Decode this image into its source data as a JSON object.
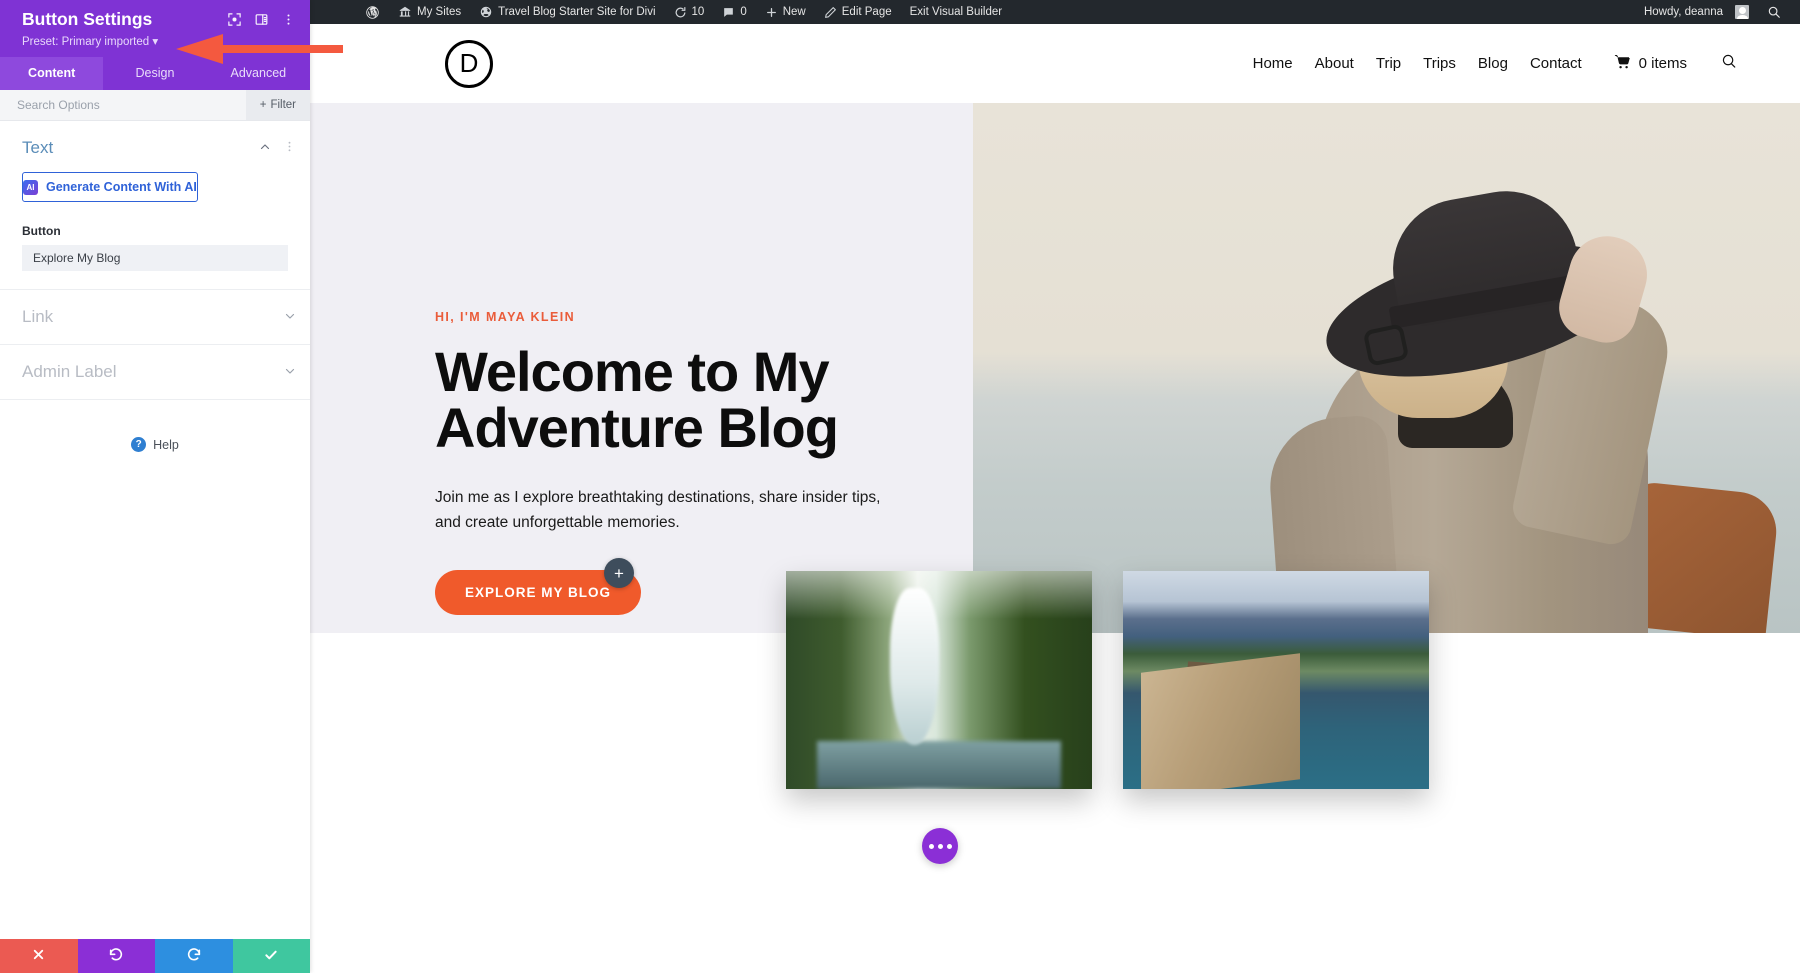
{
  "adminbar": {
    "items": [
      {
        "icon": "wordpress-icon",
        "label": ""
      },
      {
        "icon": "my-sites-icon",
        "label": "My Sites"
      },
      {
        "icon": "site-icon",
        "label": "Travel Blog Starter Site for Divi"
      },
      {
        "icon": "updates-icon",
        "label": "10"
      },
      {
        "icon": "comments-icon",
        "label": "0"
      },
      {
        "icon": "plus-icon",
        "label": "New"
      },
      {
        "icon": "pencil-icon",
        "label": "Edit Page"
      },
      {
        "icon": "",
        "label": "Exit Visual Builder"
      }
    ],
    "howdy": "Howdy, deanna",
    "search_icon": "search-icon"
  },
  "panel": {
    "title": "Button Settings",
    "preset": "Preset: Primary imported",
    "preset_caret": "▾",
    "header_icons": [
      "target-icon",
      "layout-toggle-icon",
      "kebab-menu-icon"
    ],
    "tabs": [
      {
        "label": "Content",
        "active": true
      },
      {
        "label": "Design",
        "active": false
      },
      {
        "label": "Advanced",
        "active": false
      }
    ],
    "search_placeholder": "Search Options",
    "search_value": "",
    "filter_label": "Filter",
    "filter_icon": "plus-icon",
    "sections": [
      {
        "name": "Text",
        "open": true
      },
      {
        "name": "Link",
        "open": false
      },
      {
        "name": "Admin Label",
        "open": false
      }
    ],
    "ai_button": "Generate Content With AI",
    "ai_badge": "AI",
    "button_field_label": "Button",
    "button_field_value": "Explore My Blog",
    "help_label": "Help",
    "footer": [
      {
        "name": "discard",
        "icon": "✖",
        "color": "#eb5a52"
      },
      {
        "name": "undo",
        "icon": "↺",
        "color": "#8b2fd6"
      },
      {
        "name": "redo",
        "icon": "↻",
        "color": "#2d8fe0"
      },
      {
        "name": "save",
        "icon": "✔",
        "color": "#3fc79f"
      }
    ]
  },
  "site": {
    "logo": "D",
    "nav": [
      "Home",
      "About",
      "Trip",
      "Trips",
      "Blog",
      "Contact"
    ],
    "cart_label": "0 items",
    "hero": {
      "eyebrow": "HI, I'M MAYA KLEIN",
      "title_line1": "Welcome to My",
      "title_line2": "Adventure Blog",
      "subtitle": "Join me as I explore breathtaking destinations, share insider tips, and create unforgettable memories.",
      "cta": "EXPLORE MY BLOG",
      "accent_color": "#f05a2b",
      "background_color": "#f0eff4"
    },
    "add_module_icon": "plus-icon",
    "page_settings_icon": "ellipsis-icon"
  }
}
